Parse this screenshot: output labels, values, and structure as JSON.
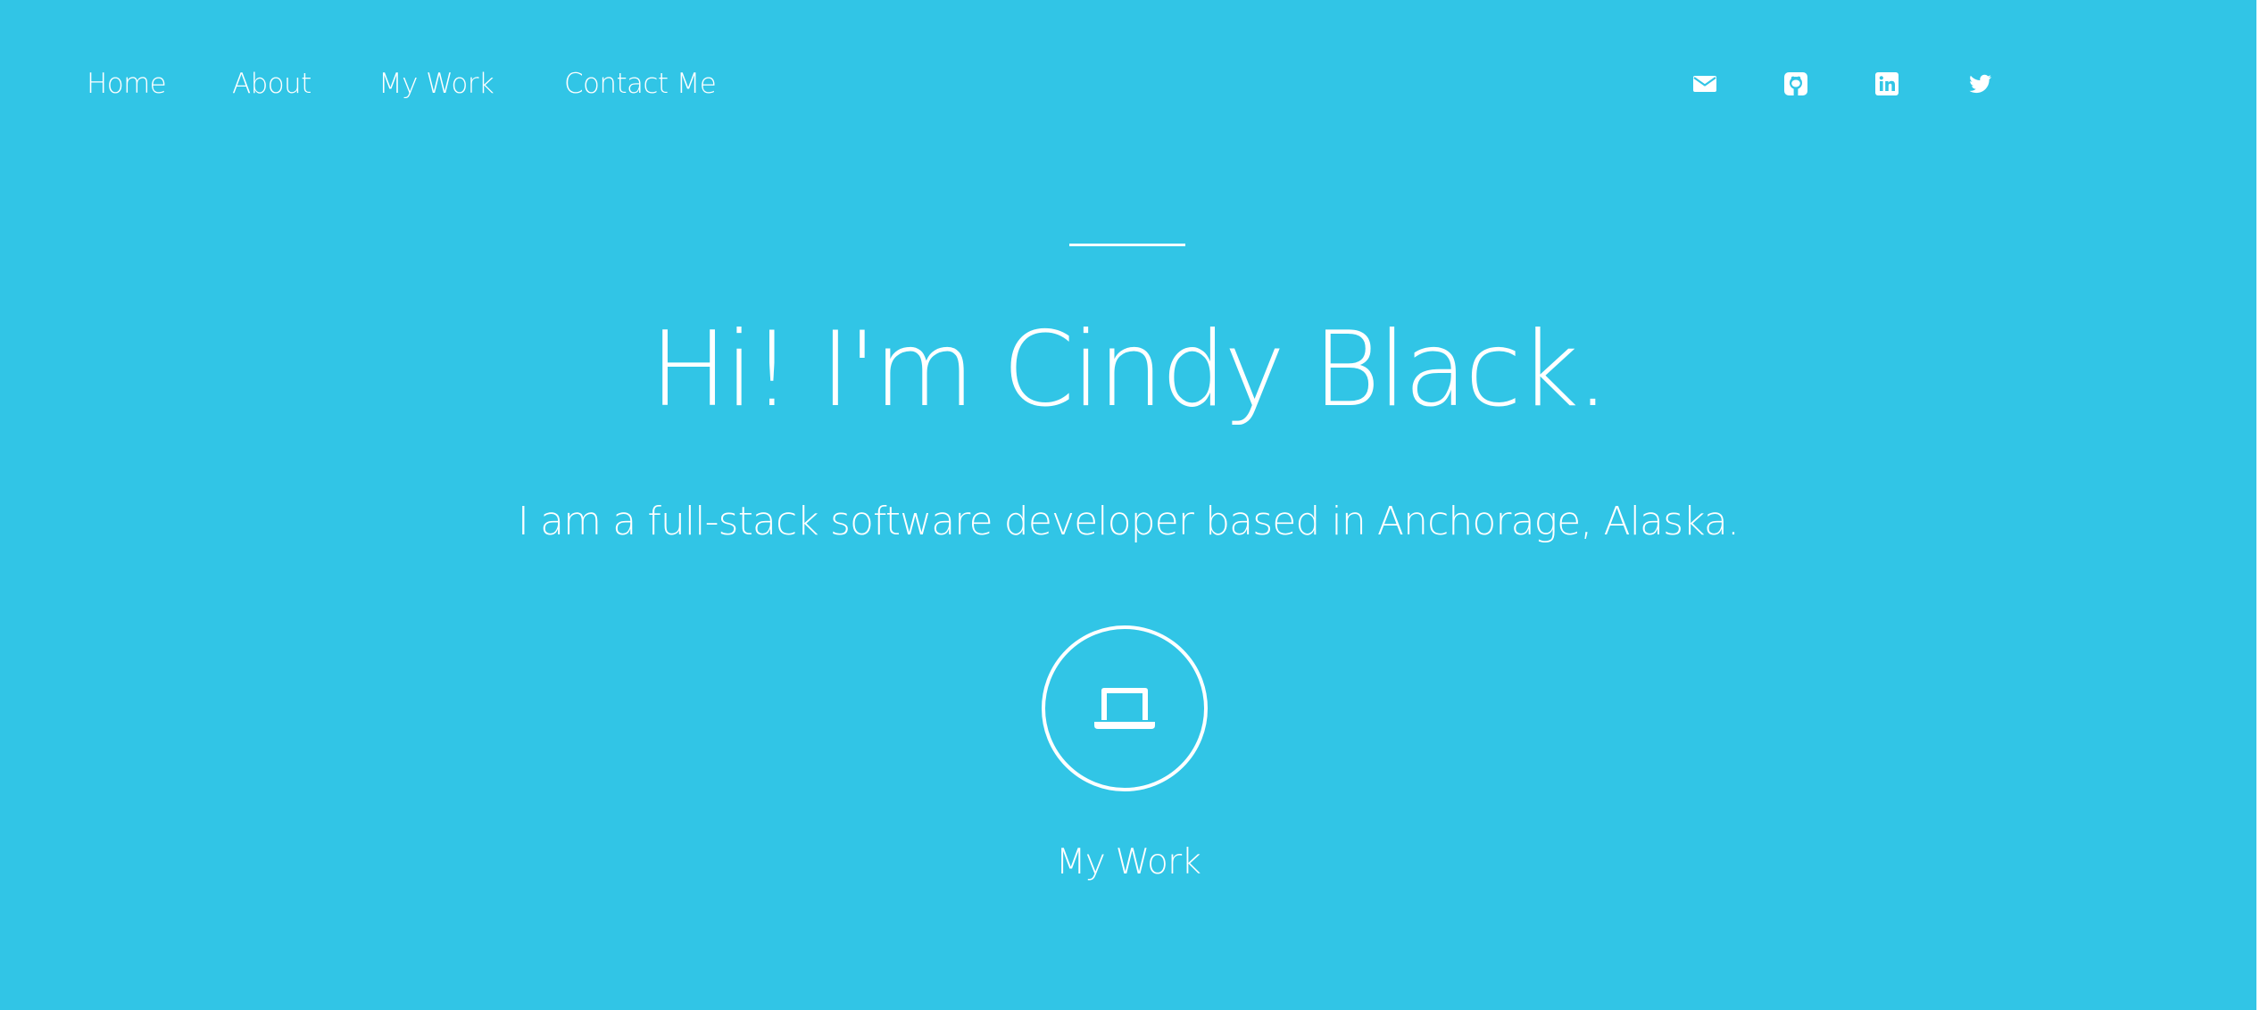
{
  "nav": {
    "items": [
      {
        "label": "Home"
      },
      {
        "label": "About"
      },
      {
        "label": "My Work"
      },
      {
        "label": "Contact Me"
      }
    ]
  },
  "social": {
    "icons": [
      "envelope-icon",
      "github-icon",
      "linkedin-icon",
      "twitter-icon"
    ]
  },
  "hero": {
    "headline": "Hi! I'm Cindy Black.",
    "tagline": "I am a full-stack software developer based in Anchorage, Alaska.",
    "cta_icon": "laptop-icon",
    "cta_label": "My Work"
  },
  "colors": {
    "background": "#31c5e6",
    "foreground": "#ffffff"
  }
}
